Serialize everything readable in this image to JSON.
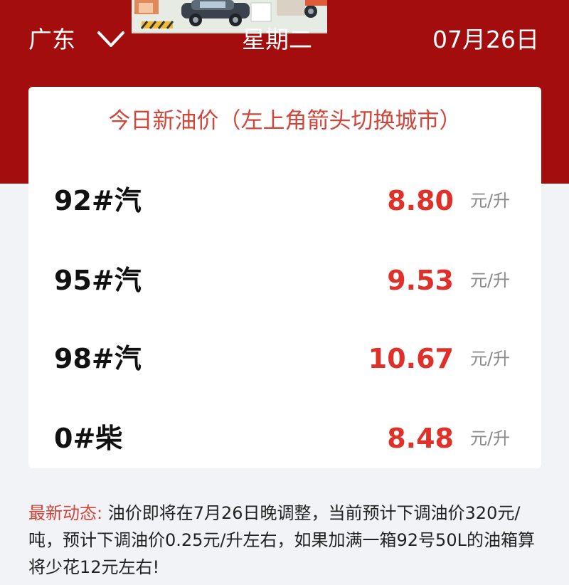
{
  "header": {
    "city": "广东",
    "weekday": "星期二",
    "date": "07月26日"
  },
  "card": {
    "title": "今日新油价（左上角箭头切换城市）",
    "rows": [
      {
        "name": "92#汽",
        "price": "8.80",
        "unit": "元/升"
      },
      {
        "name": "95#汽",
        "price": "9.53",
        "unit": "元/升"
      },
      {
        "name": "98#汽",
        "price": "10.67",
        "unit": "元/升"
      },
      {
        "name": "0#柴",
        "price": "8.48",
        "unit": "元/升"
      }
    ]
  },
  "news": {
    "label": "最新动态:",
    "text": " 油价即将在7月26日晚调整，当前预计下调油价320元/吨，预计下调油价0.25元/升左右，如果加满一箱92号50L的油箱算将少花12元左右!"
  },
  "colors": {
    "header_bg": "#a30d0d",
    "accent": "#d2453a",
    "price": "#e0302a"
  }
}
